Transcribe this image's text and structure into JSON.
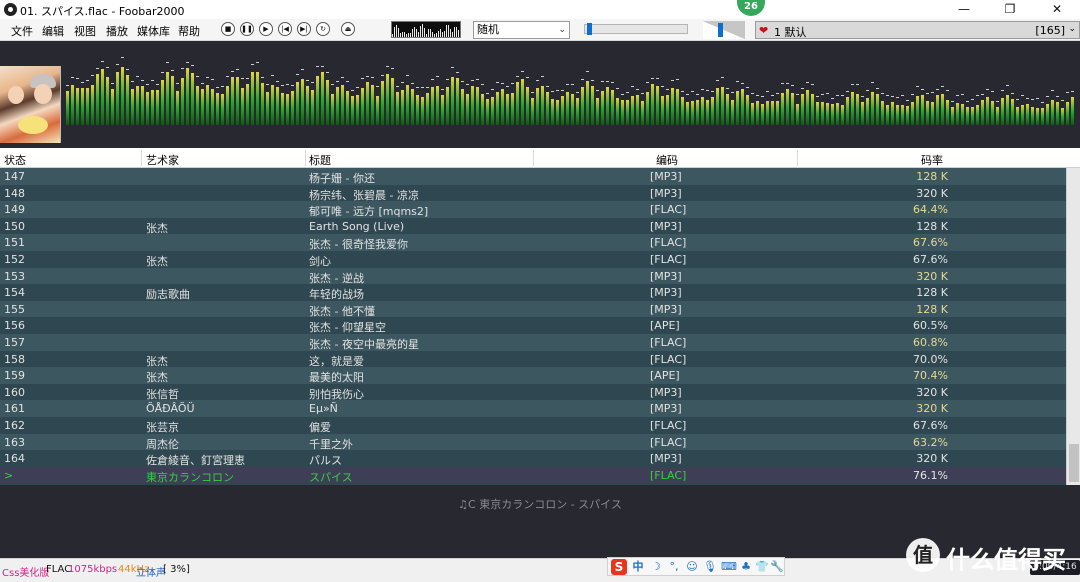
{
  "window": {
    "title": "01. スパイス.flac - Foobar2000",
    "minimize_glyph": "—",
    "maximize_glyph": "❐",
    "close_glyph": "✕"
  },
  "badge": "26",
  "menu": [
    "文件",
    "编辑",
    "视图",
    "播放",
    "媒体库",
    "帮助"
  ],
  "transport": [
    {
      "name": "stop",
      "glyph": "■"
    },
    {
      "name": "pause",
      "glyph": "❚❚"
    },
    {
      "name": "play",
      "glyph": "▶"
    },
    {
      "name": "previous",
      "glyph": "|◀"
    },
    {
      "name": "next",
      "glyph": "▶|"
    },
    {
      "name": "random",
      "glyph": "↻"
    },
    {
      "name": "open",
      "glyph": "⏏"
    }
  ],
  "playback_order": {
    "value": "随机",
    "chev": "⌄"
  },
  "seek_position": 0.02,
  "volume_level": 0.4,
  "playlist_selector": {
    "name": "1 默认",
    "count": "[165]",
    "heart": "❤",
    "chev": "⌄"
  },
  "columns": [
    "状态",
    "艺术家",
    "标题",
    "编码",
    "码率"
  ],
  "tracks": [
    {
      "num": "147",
      "artist": "",
      "title": "杨子姗 - 你还",
      "codec": "[MP3]",
      "bitrate": "128 K"
    },
    {
      "num": "148",
      "artist": "",
      "title": "杨宗纬、张碧晨 - 凉凉",
      "codec": "[MP3]",
      "bitrate": "320 K"
    },
    {
      "num": "149",
      "artist": "",
      "title": "郁可唯 - 远方 [mqms2]",
      "codec": "[FLAC]",
      "bitrate": "64.4%"
    },
    {
      "num": "150",
      "artist": "张杰",
      "title": "Earth Song (Live)",
      "codec": "[MP3]",
      "bitrate": "128 K"
    },
    {
      "num": "151",
      "artist": "",
      "title": "张杰 - 很奇怪我爱你",
      "codec": "[FLAC]",
      "bitrate": "67.6%"
    },
    {
      "num": "152",
      "artist": "张杰",
      "title": "剑心",
      "codec": "[FLAC]",
      "bitrate": "67.6%"
    },
    {
      "num": "153",
      "artist": "",
      "title": "张杰 - 逆战",
      "codec": "[MP3]",
      "bitrate": "320 K"
    },
    {
      "num": "154",
      "artist": "励志歌曲",
      "title": "年轻的战场",
      "codec": "[MP3]",
      "bitrate": "128 K"
    },
    {
      "num": "155",
      "artist": "",
      "title": "张杰 - 他不懂",
      "codec": "[MP3]",
      "bitrate": "128 K"
    },
    {
      "num": "156",
      "artist": "",
      "title": "张杰 - 仰望星空",
      "codec": "[APE]",
      "bitrate": "60.5%"
    },
    {
      "num": "157",
      "artist": "",
      "title": "张杰 - 夜空中最亮的星",
      "codec": "[FLAC]",
      "bitrate": "60.8%"
    },
    {
      "num": "158",
      "artist": "张杰",
      "title": "这，就是爱",
      "codec": "[FLAC]",
      "bitrate": "70.0%"
    },
    {
      "num": "159",
      "artist": "张杰",
      "title": "最美的太阳",
      "codec": "[APE]",
      "bitrate": "70.4%"
    },
    {
      "num": "160",
      "artist": "张信哲",
      "title": "别怕我伤心",
      "codec": "[MP3]",
      "bitrate": "320 K"
    },
    {
      "num": "161",
      "artist": "ÕÅÐÂÕÜ",
      "title": "Eµ»Ñ",
      "codec": "[MP3]",
      "bitrate": "320 K"
    },
    {
      "num": "162",
      "artist": "张芸京",
      "title": "偏爱",
      "codec": "[FLAC]",
      "bitrate": "67.6%"
    },
    {
      "num": "163",
      "artist": "周杰伦",
      "title": "千里之外",
      "codec": "[FLAC]",
      "bitrate": "63.2%"
    },
    {
      "num": "164",
      "artist": "佐倉綾音、釘宮理恵",
      "title": "パルス",
      "codec": "[MP3]",
      "bitrate": "320 K"
    },
    {
      "num": ">",
      "artist": "東京カランコロン",
      "title": "スパイス",
      "codec": "[FLAC]",
      "bitrate": "76.1%",
      "current": true
    }
  ],
  "now_playing": "♫C 東京カランコロン - スパイス",
  "status": {
    "css_label": "Css美化版",
    "format": "FLAC",
    "bitrate": "1075kbps",
    "samplerate": "44kHz",
    "channels": "立体声",
    "buffer": "[ 3%]",
    "time": "0:09/4:16"
  },
  "tray": {
    "ime_logo": "S",
    "ime_lang": "中",
    "icons": [
      {
        "name": "moon-icon",
        "glyph": "☽"
      },
      {
        "name": "punctuation-icon",
        "glyph": "°,"
      },
      {
        "name": "emoji-icon",
        "glyph": "☺"
      },
      {
        "name": "microphone-icon",
        "glyph": "🎙"
      },
      {
        "name": "keyboard-icon",
        "glyph": "⌨"
      },
      {
        "name": "skin-icon",
        "glyph": "♣"
      },
      {
        "name": "tshirt-icon",
        "glyph": "👕"
      },
      {
        "name": "wrench-icon",
        "glyph": "🔧"
      }
    ]
  },
  "watermark": {
    "logo": "值",
    "text": "什么值得买"
  }
}
